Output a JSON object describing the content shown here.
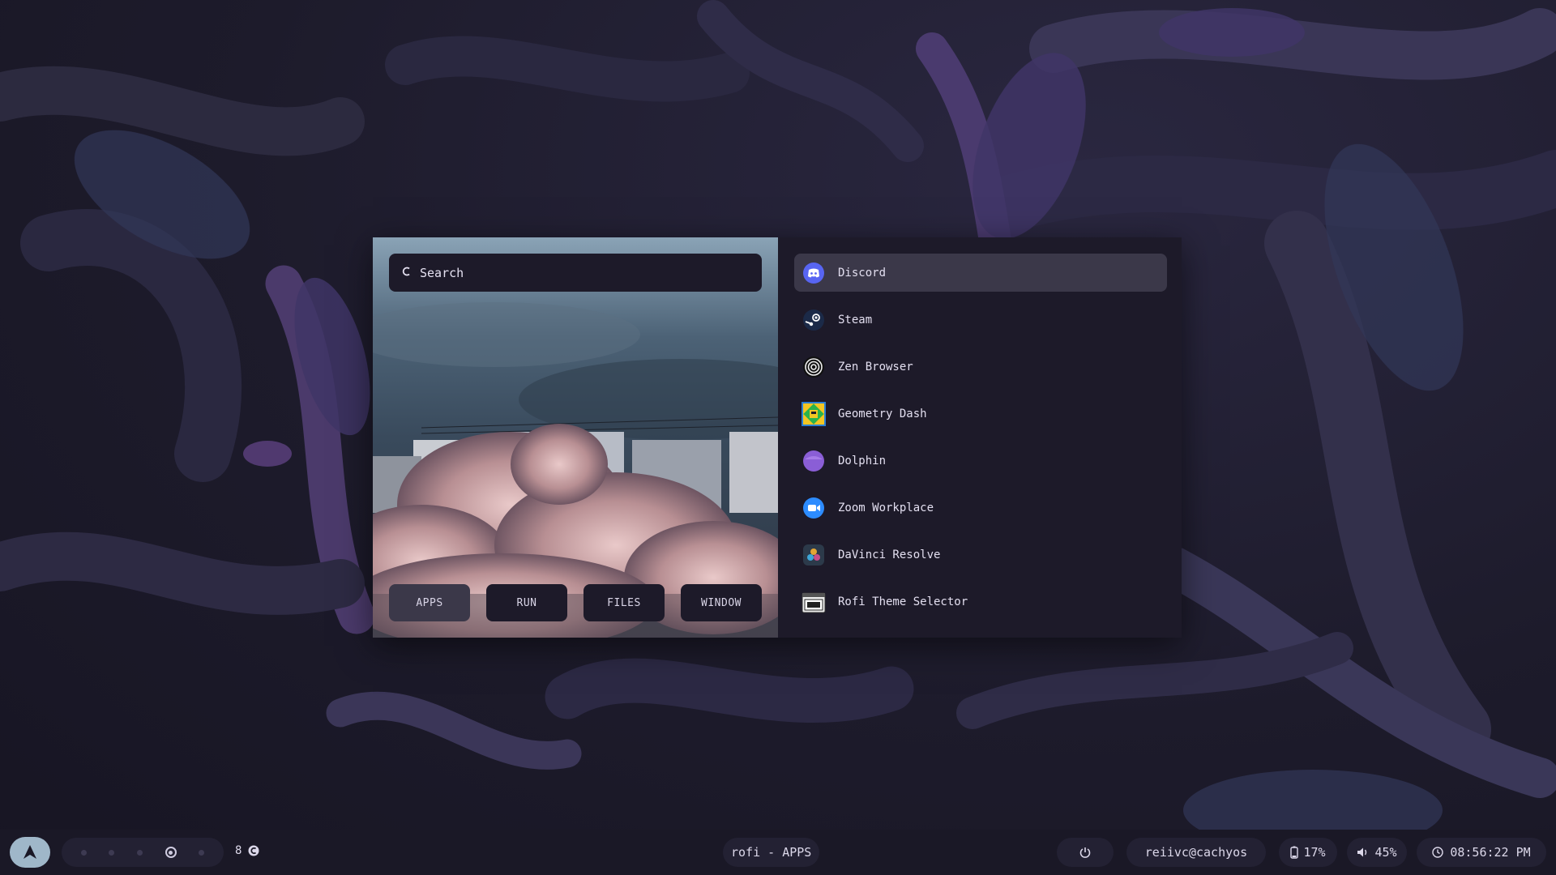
{
  "rofi": {
    "search_placeholder": "Search",
    "search_icon": "search-icon",
    "modes": [
      {
        "label": "APPS",
        "active": true
      },
      {
        "label": "RUN",
        "active": false
      },
      {
        "label": "FILES",
        "active": false
      },
      {
        "label": "WINDOW",
        "active": false
      }
    ],
    "apps": [
      {
        "name": "Discord",
        "icon": "discord-icon",
        "selected": true
      },
      {
        "name": "Steam",
        "icon": "steam-icon"
      },
      {
        "name": "Zen Browser",
        "icon": "zen-browser-icon"
      },
      {
        "name": "Geometry Dash",
        "icon": "geometry-dash-icon"
      },
      {
        "name": "Dolphin",
        "icon": "dolphin-icon"
      },
      {
        "name": "Zoom Workplace",
        "icon": "zoom-icon"
      },
      {
        "name": "DaVinci Resolve",
        "icon": "davinci-resolve-icon"
      },
      {
        "name": "Rofi Theme Selector",
        "icon": "rofi-theme-selector-icon"
      }
    ]
  },
  "taskbar": {
    "workspace_count": "8",
    "window_title": "rofi - APPS",
    "user": "reiivc@cachyos",
    "battery": "17%",
    "volume": "45%",
    "clock": "08:56:22 PM"
  },
  "colors": {
    "panel": "#1d1a29",
    "selected": "#3b3849",
    "text": "#e3dff0",
    "launcher": "#9fb7c9"
  }
}
